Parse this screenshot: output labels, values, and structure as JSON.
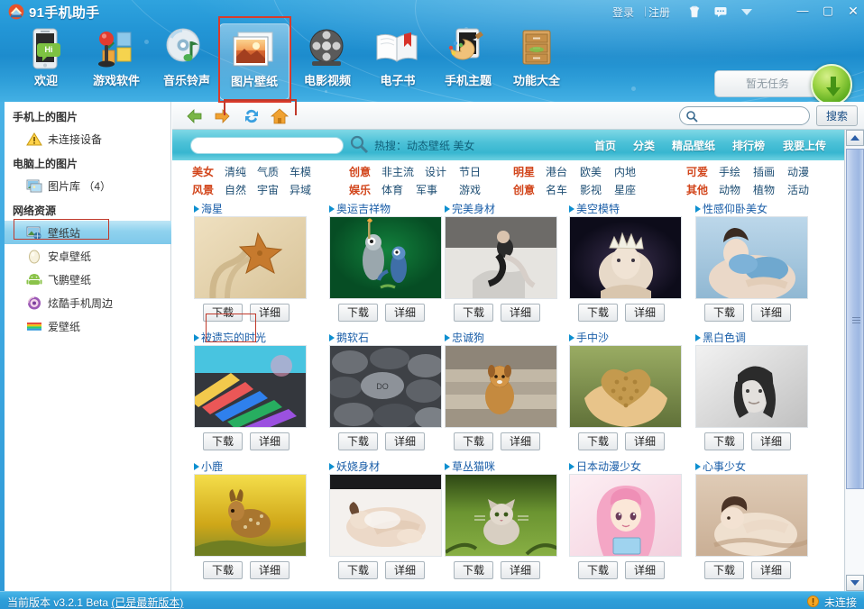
{
  "window": {
    "app_title": "91手机助手",
    "logo_icon": "app-logo-icon",
    "account": {
      "login": "登录",
      "separator": "|",
      "register": "注册"
    },
    "header_icons": [
      {
        "name": "skin-icon",
        "glyph": "👕"
      },
      {
        "name": "message-icon",
        "glyph": "💬"
      },
      {
        "name": "dropdown-icon",
        "glyph": "▼"
      }
    ],
    "controls": {
      "minimize": "—",
      "maximize": "▢",
      "close": "✕"
    }
  },
  "toolbar": {
    "items": [
      {
        "label": "欢迎",
        "icon": "phone-hi-icon",
        "active": false
      },
      {
        "label": "游戏软件",
        "icon": "games-software-icon",
        "active": false
      },
      {
        "label": "音乐铃声",
        "icon": "music-ringtone-icon",
        "active": false
      },
      {
        "label": "图片壁纸",
        "icon": "picture-wallpaper-icon",
        "active": true
      },
      {
        "label": "电影视频",
        "icon": "movie-video-icon",
        "active": false
      },
      {
        "label": "电子书",
        "icon": "ebook-icon",
        "active": false
      },
      {
        "label": "手机主题",
        "icon": "phone-theme-icon",
        "active": false
      },
      {
        "label": "功能大全",
        "icon": "all-functions-icon",
        "active": false
      }
    ],
    "download_task_label": "暂无任务",
    "download_orb_icon": "download-arrow-icon"
  },
  "sidebar": {
    "groups": [
      {
        "title": "手机上的图片",
        "items": [
          {
            "label": "未连接设备",
            "icon": "warning-icon",
            "selected": false
          }
        ]
      },
      {
        "title": "电脑上的图片",
        "items": [
          {
            "label": "图片库 （4）",
            "icon": "picture-library-icon",
            "selected": false
          }
        ]
      },
      {
        "title": "网络资源",
        "items": [
          {
            "label": "壁纸站",
            "icon": "wallpaper-site-icon",
            "selected": true
          },
          {
            "label": "安卓壁纸",
            "icon": "android-wallpaper-icon",
            "selected": false
          },
          {
            "label": "飞鹏壁纸",
            "icon": "feipeng-wallpaper-icon",
            "selected": false
          },
          {
            "label": "炫酷手机周边",
            "icon": "cool-phone-accessories-icon",
            "selected": false
          },
          {
            "label": "爱壁纸",
            "icon": "love-wallpaper-icon",
            "selected": false
          }
        ]
      }
    ]
  },
  "browse_bar": {
    "back_icon": "back-arrow-icon",
    "forward_icon": "forward-arrow-icon",
    "refresh_icon": "refresh-icon",
    "home_icon": "home-icon",
    "search_value": "",
    "search_icon": "search-icon",
    "search_button": "搜索"
  },
  "site_bar": {
    "search_value": "",
    "search_icon": "search-icon",
    "hot_search": "热搜：动态壁纸 美女",
    "nav": [
      {
        "label": "首页"
      },
      {
        "label": "分类"
      },
      {
        "label": "精品壁纸"
      },
      {
        "label": "排行榜"
      },
      {
        "label": "我要上传"
      }
    ]
  },
  "categories": {
    "columns": [
      {
        "rows": [
          {
            "head": "美女",
            "tags": [
              "清纯",
              "气质",
              "车模"
            ]
          },
          {
            "head": "风景",
            "tags": [
              "自然",
              "宇宙",
              "异域"
            ]
          }
        ]
      },
      {
        "rows": [
          {
            "head": "创意",
            "tags": [
              "非主流",
              "设计",
              "节日"
            ]
          },
          {
            "head": "娱乐",
            "tags": [
              "体育",
              "军事",
              "游戏"
            ]
          }
        ]
      },
      {
        "rows": [
          {
            "head": "明星",
            "tags": [
              "港台",
              "欧美",
              "内地"
            ]
          },
          {
            "head": "创意",
            "tags": [
              "名车",
              "影视",
              "星座"
            ]
          }
        ]
      },
      {
        "rows": [
          {
            "head": "可爱",
            "tags": [
              "手绘",
              "插画",
              "动漫"
            ]
          },
          {
            "head": "其他",
            "tags": [
              "动物",
              "植物",
              "活动"
            ]
          }
        ]
      }
    ]
  },
  "grid": {
    "download_label": "下载",
    "detail_label": "详细",
    "items": [
      {
        "title": "海星",
        "thumb": "starfish-sand"
      },
      {
        "title": "奥运吉祥物",
        "thumb": "olympic-mascots"
      },
      {
        "title": "完美身材",
        "thumb": "bw-model-sitting"
      },
      {
        "title": "美空模特",
        "thumb": "crown-model-dark"
      },
      {
        "title": "性感仰卧美女",
        "thumb": "blue-lingerie-model"
      },
      {
        "title": "被遗忘的时光",
        "thumb": "colored-pencils"
      },
      {
        "title": "鹅软石",
        "thumb": "gray-pebbles"
      },
      {
        "title": "忠诚狗",
        "thumb": "dog-on-steps"
      },
      {
        "title": "手中沙",
        "thumb": "heart-sand-hands"
      },
      {
        "title": "黑白色调",
        "thumb": "bw-portrait"
      },
      {
        "title": "小鹿",
        "thumb": "deer-in-grass"
      },
      {
        "title": "妖娆身材",
        "thumb": "white-lying-model"
      },
      {
        "title": "草丛猫咪",
        "thumb": "cat-in-grass"
      },
      {
        "title": "日本动漫少女",
        "thumb": "anime-girl-pink"
      },
      {
        "title": "心事少女",
        "thumb": "girl-on-bed"
      }
    ]
  },
  "scrollbar": {
    "up_icon": "scroll-up-icon",
    "down_icon": "scroll-down-icon"
  },
  "status_bar": {
    "version_prefix": "当前版本 v3.2.1 Beta ",
    "version_note": "(已是最新版本)",
    "connection_icon": "warning-icon",
    "connection": "未连接"
  },
  "colors": {
    "header_blue": "#2396d6",
    "teal_bar": "#4ec2d8",
    "accent_orange": "#d2451b",
    "link_blue": "#1a5ea8",
    "selection_blue": "#8fd2ee",
    "annotation_red": "#d93b2b"
  }
}
